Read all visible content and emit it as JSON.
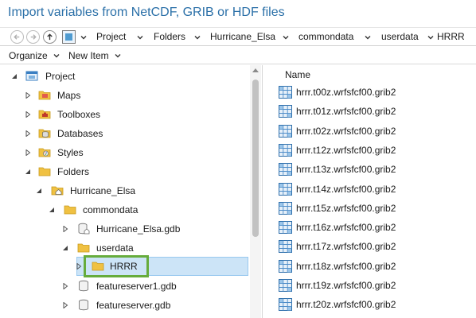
{
  "window": {
    "title": "Import variables from NetCDF, GRIB or HDF files"
  },
  "addressbar": {
    "back_icon": "back-arrow-icon",
    "forward_icon": "forward-arrow-icon",
    "up_icon": "up-arrow-icon",
    "breadcrumbs": [
      "Project",
      "Folders",
      "Hurricane_Elsa",
      "commondata",
      "userdata",
      "HRRR"
    ]
  },
  "toolbar": {
    "organize_label": "Organize",
    "new_item_label": "New Item"
  },
  "tree": {
    "items": [
      {
        "label": "Project",
        "icon": "project-icon",
        "expander": "expanded"
      },
      {
        "label": "Maps",
        "icon": "maps-folder-icon",
        "expander": "collapsed"
      },
      {
        "label": "Toolboxes",
        "icon": "toolboxes-folder-icon",
        "expander": "collapsed"
      },
      {
        "label": "Databases",
        "icon": "databases-folder-icon",
        "expander": "collapsed"
      },
      {
        "label": "Styles",
        "icon": "styles-folder-icon",
        "expander": "collapsed"
      },
      {
        "label": "Folders",
        "icon": "folders-icon",
        "expander": "expanded"
      },
      {
        "label": "Hurricane_Elsa",
        "icon": "home-folder-icon",
        "expander": "expanded"
      },
      {
        "label": "commondata",
        "icon": "folder-icon",
        "expander": "expanded"
      },
      {
        "label": "Hurricane_Elsa.gdb",
        "icon": "geodatabase-icon",
        "expander": "collapsed"
      },
      {
        "label": "userdata",
        "icon": "folder-icon",
        "expander": "expanded"
      },
      {
        "label": "HRRR",
        "icon": "folder-icon",
        "expander": "collapsed",
        "selected": true
      },
      {
        "label": "featureserver1.gdb",
        "icon": "geodatabase-icon",
        "expander": "collapsed"
      },
      {
        "label": "featureserver.gdb",
        "icon": "geodatabase-icon",
        "expander": "collapsed"
      }
    ]
  },
  "list": {
    "column_name": "Name",
    "files": [
      "hrrr.t00z.wrfsfcf00.grib2",
      "hrrr.t01z.wrfsfcf00.grib2",
      "hrrr.t02z.wrfsfcf00.grib2",
      "hrrr.t12z.wrfsfcf00.grib2",
      "hrrr.t13z.wrfsfcf00.grib2",
      "hrrr.t14z.wrfsfcf00.grib2",
      "hrrr.t15z.wrfsfcf00.grib2",
      "hrrr.t16z.wrfsfcf00.grib2",
      "hrrr.t17z.wrfsfcf00.grib2",
      "hrrr.t18z.wrfsfcf00.grib2",
      "hrrr.t19z.wrfsfcf00.grib2",
      "hrrr.t20z.wrfsfcf00.grib2"
    ]
  },
  "colors": {
    "title": "#2b70a8",
    "selection": "#cce4f7",
    "highlight": "#66ac3c",
    "folder": "#f0c142"
  }
}
